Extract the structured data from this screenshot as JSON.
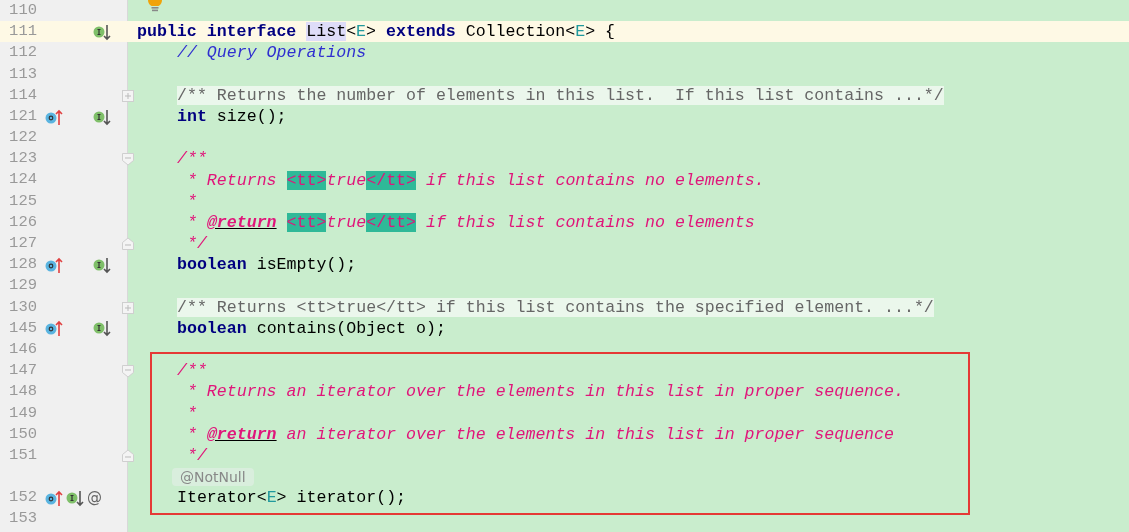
{
  "editor": {
    "lines": [
      {
        "number": "110",
        "current": false,
        "intention_bulb": true
      },
      {
        "number": "111",
        "current": true,
        "gutter": [
          {
            "kind": "implemented"
          }
        ],
        "tokens": [
          {
            "kind": "keyword",
            "text": "public interface "
          },
          {
            "kind": "usage",
            "text": "List"
          },
          {
            "kind": "plain",
            "text": "<"
          },
          {
            "kind": "typeparam",
            "text": "E"
          },
          {
            "kind": "plain",
            "text": "> "
          },
          {
            "kind": "keyword",
            "text": "extends "
          },
          {
            "kind": "plain",
            "text": "Collection<"
          },
          {
            "kind": "typeparam",
            "text": "E"
          },
          {
            "kind": "plain",
            "text": "> {"
          }
        ],
        "children": [
          {
            "kind": "line",
            "number": "112",
            "current": false,
            "tokens": [
              {
                "kind": "comment",
                "text": "// Query Operations"
              }
            ]
          },
          {
            "kind": "line",
            "number": "113",
            "current": false
          },
          {
            "kind": "line",
            "number": "114",
            "current": false,
            "collapsed": true,
            "tokens": [
              {
                "kind": "folded",
                "text": "/** Returns the number of elements in this list.  If this list contains ...*/"
              }
            ]
          },
          {
            "kind": "line",
            "number": "121",
            "current": false,
            "gutter": [
              {
                "kind": "overriding"
              },
              {
                "kind": "implemented"
              }
            ],
            "tokens": [
              {
                "kind": "keyword",
                "text": "int "
              },
              {
                "kind": "plain",
                "text": "size();"
              }
            ]
          },
          {
            "kind": "line",
            "number": "122",
            "current": false
          },
          {
            "kind": "line",
            "number": "123",
            "current": false,
            "fold_start": true,
            "tokens": [
              {
                "kind": "doc",
                "text": "/**"
              }
            ]
          },
          {
            "kind": "line",
            "number": "124",
            "current": false,
            "tokens": [
              {
                "kind": "doc",
                "text": " * Returns "
              },
              {
                "kind": "dochtml",
                "text": "<tt>"
              },
              {
                "kind": "doc",
                "text": "true"
              },
              {
                "kind": "dochtml",
                "text": "</tt>"
              },
              {
                "kind": "doc",
                "text": " if this list contains no elements."
              }
            ]
          },
          {
            "kind": "line",
            "number": "125",
            "current": false,
            "tokens": [
              {
                "kind": "doc",
                "text": " *"
              }
            ]
          },
          {
            "kind": "line",
            "number": "126",
            "current": false,
            "tokens": [
              {
                "kind": "doc",
                "text": " * "
              },
              {
                "kind": "doctag",
                "text": "@return"
              },
              {
                "kind": "dochtml",
                "text": "<tt>"
              },
              {
                "kind": "doc",
                "text": "true"
              },
              {
                "kind": "dochtml",
                "text": "</tt>"
              },
              {
                "kind": "doc",
                "text": " if this list contains no elements"
              }
            ]
          },
          {
            "kind": "line",
            "number": "127",
            "current": false,
            "fold_end": true,
            "tokens": [
              {
                "kind": "doc",
                "text": " */"
              }
            ]
          },
          {
            "kind": "line",
            "number": "128",
            "current": false,
            "gutter": [
              {
                "kind": "overriding"
              },
              {
                "kind": "implemented"
              }
            ],
            "tokens": [
              {
                "kind": "keyword",
                "text": "boolean "
              },
              {
                "kind": "plain",
                "text": "isEmpty();"
              }
            ]
          },
          {
            "kind": "line",
            "number": "129",
            "current": false
          },
          {
            "kind": "line",
            "number": "130",
            "current": false,
            "collapsed": true,
            "tokens": [
              {
                "kind": "folded",
                "text": "/** Returns <tt>true</tt> if this list contains the specified element. ...*/"
              }
            ]
          },
          {
            "kind": "line",
            "number": "145",
            "current": false,
            "gutter": [
              {
                "kind": "overriding"
              },
              {
                "kind": "implemented"
              }
            ],
            "tokens": [
              {
                "kind": "keyword",
                "text": "boolean "
              },
              {
                "kind": "plain",
                "text": "contains(Object o);"
              }
            ]
          },
          {
            "kind": "line",
            "number": "146",
            "current": false
          },
          {
            "kind": "frame",
            "lines": [
              {
                "number": "147",
                "current": false,
                "fold_start": true,
                "tokens": [
                  {
                    "kind": "doc",
                    "text": "/**"
                  }
                ]
              },
              {
                "number": "148",
                "current": false,
                "tokens": [
                  {
                    "kind": "doc",
                    "text": " * Returns an iterator over the elements in this list in proper sequence."
                  }
                ]
              },
              {
                "number": "149",
                "current": false,
                "tokens": [
                  {
                    "kind": "doc",
                    "text": " *"
                  }
                ]
              },
              {
                "number": "150",
                "current": false,
                "tokens": [
                  {
                    "kind": "doc",
                    "text": " * "
                  },
                  {
                    "kind": "doctag",
                    "text": "@return"
                  },
                  {
                    "kind": "doc",
                    "text": " an iterator over the elements in this list in proper sequence"
                  }
                ]
              },
              {
                "number": "151",
                "current": false,
                "fold_end": true,
                "tokens": [
                  {
                    "kind": "doc",
                    "text": " */"
                  }
                ]
              },
              {
                "hint": "@NotNull"
              },
              {
                "number": "152",
                "current": false,
                "gutter": [
                  {
                    "kind": "overriding"
                  },
                  {
                    "kind": "implemented"
                  },
                  {
                    "kind": "annotation",
                    "text": "@"
                  }
                ],
                "tokens": [
                  {
                    "kind": "plain",
                    "text": "Iterator<"
                  },
                  {
                    "kind": "typeparam",
                    "text": "E"
                  },
                  {
                    "kind": "plain",
                    "text": "> iterator();"
                  }
                ]
              }
            ]
          },
          {
            "kind": "line",
            "number": "153",
            "current": false
          }
        ]
      }
    ]
  }
}
